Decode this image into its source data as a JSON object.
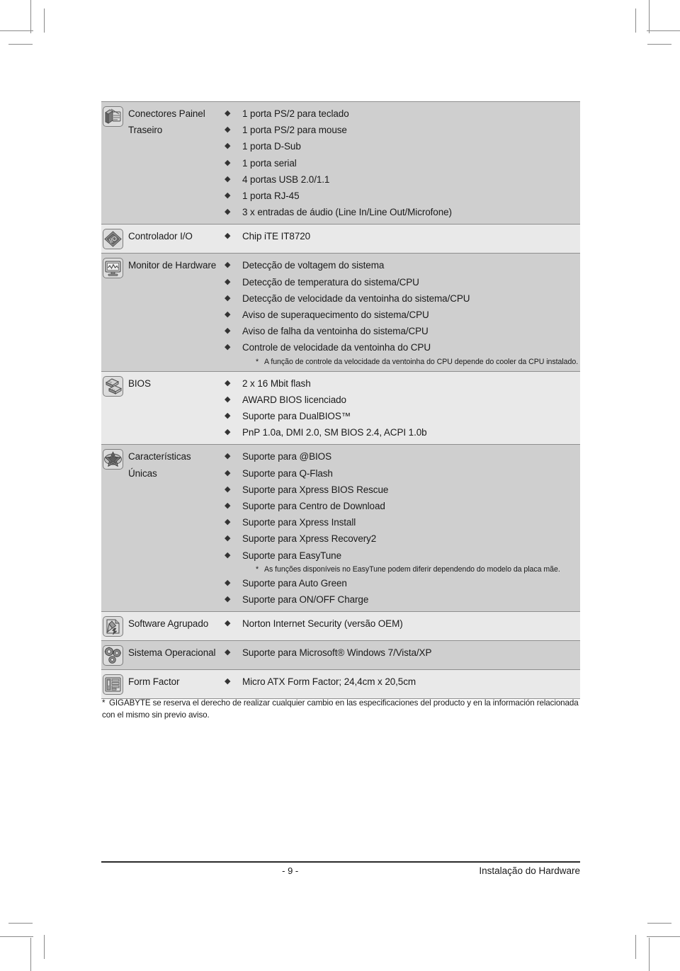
{
  "page": {
    "number": "- 9 -",
    "section": "Instalação do Hardware",
    "footnote_marker": "*",
    "footnote": "GIGABYTE se reserva el derecho de realizar cualquier cambio en las especificaciones del producto y en la información relacionada con el mismo sin previo aviso."
  },
  "spec_table": {
    "rows": [
      {
        "icon": "rear-panel-connectors-icon",
        "label_lines": [
          "Conectores Painel",
          "Traseiro"
        ],
        "shade": "dark",
        "items": [
          {
            "text": "1 porta PS/2 para teclado"
          },
          {
            "text": "1 porta PS/2 para mouse"
          },
          {
            "text": "1 porta D-Sub"
          },
          {
            "text": "1 porta serial"
          },
          {
            "text": "4 portas USB 2.0/1.1"
          },
          {
            "text": "1 porta RJ-45"
          },
          {
            "text": "3 x entradas de áudio (Line In/Line Out/Microfone)"
          }
        ],
        "notes": []
      },
      {
        "icon": "io-controller-icon",
        "label_lines": [
          "Controlador I/O"
        ],
        "shade": "light",
        "items": [
          {
            "text": "Chip iTE IT8720"
          }
        ],
        "notes": []
      },
      {
        "icon": "hardware-monitor-icon",
        "label_lines": [
          "Monitor de Hardware"
        ],
        "shade": "dark",
        "items": [
          {
            "text": "Detecção de voltagem do sistema"
          },
          {
            "text": "Detecção de temperatura do sistema/CPU"
          },
          {
            "text": "Detecção de velocidade da ventoinha do sistema/CPU"
          },
          {
            "text": "Aviso de superaquecimento do sistema/CPU"
          },
          {
            "text": "Aviso de falha da ventoinha do sistema/CPU"
          },
          {
            "text": "Controle de velocidade da ventoinha do CPU"
          }
        ],
        "notes": [
          {
            "marker": "*",
            "text": "A função de controle da velocidade da ventoinha do CPU depende do cooler da CPU instalado."
          }
        ]
      },
      {
        "icon": "bios-icon",
        "label_lines": [
          "BIOS"
        ],
        "shade": "light",
        "items": [
          {
            "text": "2 x 16 Mbit flash"
          },
          {
            "text": "AWARD BIOS licenciado"
          },
          {
            "text": "Suporte para DualBIOS™"
          },
          {
            "text": "PnP 1.0a, DMI 2.0, SM BIOS 2.4, ACPI 1.0b"
          }
        ],
        "notes": []
      },
      {
        "icon": "unique-features-star-icon",
        "label_lines": [
          "Características",
          "Únicas"
        ],
        "shade": "dark",
        "items": [
          {
            "text": "Suporte para @BIOS"
          },
          {
            "text": "Suporte para Q-Flash"
          },
          {
            "text": "Suporte para Xpress BIOS Rescue"
          },
          {
            "text": "Suporte para Centro de Download"
          },
          {
            "text": "Suporte para Xpress Install"
          },
          {
            "text": "Suporte para Xpress Recovery2"
          },
          {
            "text": "Suporte para EasyTune"
          }
        ],
        "notes": [
          {
            "marker": "*",
            "text": "As funções disponíveis no EasyTune podem diferir dependendo do modelo da placa mãe."
          }
        ],
        "items_after_note": [
          {
            "text": "Suporte para Auto Green"
          },
          {
            "text": "Suporte para ON/OFF Charge"
          }
        ]
      },
      {
        "icon": "bundled-software-icon",
        "label_lines": [
          "Software Agrupado"
        ],
        "shade": "light",
        "items": [
          {
            "text": "Norton Internet Security (versão OEM)"
          }
        ],
        "notes": []
      },
      {
        "icon": "operating-system-icon",
        "label_lines": [
          "Sistema Operacional"
        ],
        "shade": "dark",
        "items": [
          {
            "text": "Suporte para Microsoft® Windows 7/Vista/XP"
          }
        ],
        "notes": []
      },
      {
        "icon": "form-factor-icon",
        "label_lines": [
          "Form Factor"
        ],
        "shade": "light",
        "items": [
          {
            "text": "Micro ATX Form Factor; 24,4cm x 20,5cm"
          }
        ],
        "notes": []
      }
    ],
    "bullet_glyph": "◆",
    "colors": {
      "row_dark": "#cfcfcf",
      "row_light": "#e9e9e9",
      "rule": "#8e8e8e",
      "text": "#1a1a1a"
    }
  }
}
